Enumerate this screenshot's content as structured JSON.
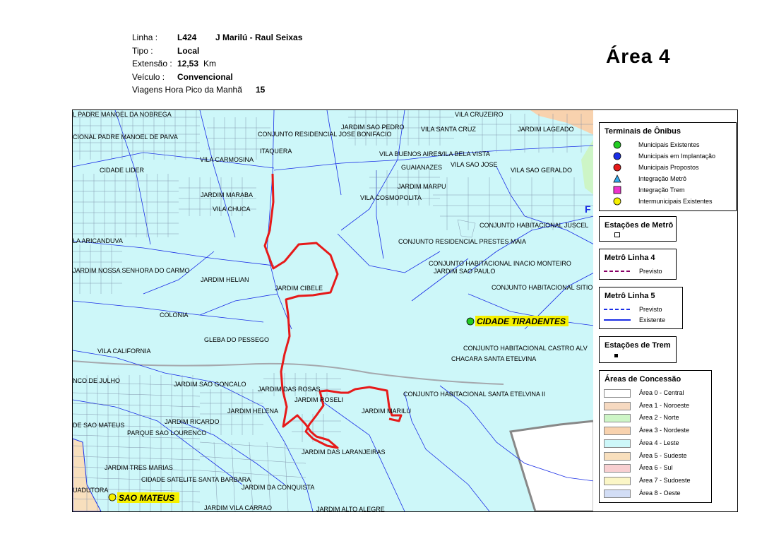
{
  "header": {
    "linha_label": "Linha :",
    "linha_code": "L424",
    "linha_name": "J Marilú - Raul Seixas",
    "tipo_label": "Tipo :",
    "tipo_value": "Local",
    "extensao_label": "Extensão :",
    "extensao_value": "12,53",
    "extensao_unit": "Km",
    "veiculo_label": "Veículo :",
    "veiculo_value": "Convencional",
    "viagens_label": "Viagens Hora Pico da Manhã",
    "viagens_value": "15"
  },
  "area_title": "Área  4",
  "map": {
    "place_labels": [
      "L PADRE MANOEL DA NOBREGA",
      "CIONAL PADRE MANOEL DE PAIVA",
      "CIDADE LIDER",
      "VILA CARMOSINA",
      "ITAQUERA",
      "CONJUNTO RESIDENCIAL JOSE BONIFACIO",
      "JARDIM SAO PEDRO",
      "VILA SANTA CRUZ",
      "VILA CRUZEIRO",
      "JARDIM LAGEADO",
      "VILA BUENOS AIRES",
      "VILA BELA VISTA",
      "GUAIANAZES",
      "VILA SAO JOSE",
      "VILA SAO GERALDO",
      "JARDIM MARPU",
      "VILA COSMOPOLITA",
      "JARDIM MARABA",
      "VILA CHUCA",
      "JARDIM HELIAN",
      "JARDIM CIBELE",
      "COLONIA",
      "GLEBA DO PESSEGO",
      "VILA CALIFORNIA",
      "JARDIM SAO GONCALO",
      "JARDIM DAS ROSAS",
      "JARDIM ROSELI",
      "JARDIM HELENA",
      "JARDIM MARILU",
      "JARDIM RICARDO",
      "PARQUE SAO LOURENCO",
      "JARDIM DAS LARANJEIRAS",
      "JARDIM TRES MARIAS",
      "CIDADE SATELITE SANTA BARBARA",
      "JARDIM DA CONQUISTA",
      "JARDIM VILA CARRAO",
      "JARDIM ALTO ALEGRE",
      "UADUTORA",
      "DE SAO MATEUS",
      "NCO DE JULHO",
      "LA ARICANDUVA",
      "JARDIM NOSSA SENHORA DO CARMO",
      "CONJUNTO RESIDENCIAL PRESTES MAIA",
      "CONJUNTO HABITACIONAL JUSCEL",
      "CONJUNTO HABITACIONAL INACIO MONTEIRO",
      "JARDIM SAO PAULO",
      "CONJUNTO HABITACIONAL SITIO",
      "CONJUNTO HABITACIONAL CASTRO ALV",
      "CHACARA SANTA ETELVINA",
      "CONJUNTO HABITACIONAL SANTA ETELVINA II",
      "F"
    ],
    "terminal_labels": [
      "CIDADE TIRADENTES",
      "SAO MATEUS"
    ]
  },
  "legend": {
    "terminais": {
      "title": "Terminais de Ônibus",
      "items": [
        {
          "label": "Municipais Existentes",
          "color": "#22cc22",
          "shape": "circle"
        },
        {
          "label": "Municipais em Implantação",
          "color": "#1a2ee6",
          "shape": "circle"
        },
        {
          "label": "Municipais Propostos",
          "color": "#e61a1a",
          "shape": "circle"
        },
        {
          "label": "Integração Metrô",
          "color": "#33aaee",
          "shape": "triangle"
        },
        {
          "label": "Integração Trem",
          "color": "#ee33cc",
          "shape": "square"
        },
        {
          "label": "Intermunicipais Existentes",
          "color": "#f5f000",
          "shape": "circle"
        }
      ]
    },
    "estacoes_metro": {
      "title": "Estações de Metrô"
    },
    "metro4": {
      "title": "Metrô Linha 4",
      "items": [
        {
          "label": "Previsto",
          "color": "#880066",
          "style": "dashed"
        }
      ]
    },
    "metro5": {
      "title": "Metrô Linha 5",
      "items": [
        {
          "label": "Previsto",
          "color": "#1a2ee6",
          "style": "dashed"
        },
        {
          "label": "Existente",
          "color": "#1a2ee6",
          "style": "solid"
        }
      ]
    },
    "estacoes_trem": {
      "title": "Estações de Trem"
    },
    "areas": {
      "title": "Áreas de Concessão",
      "items": [
        {
          "label": "Área 0 - Central",
          "color": "#ffffff"
        },
        {
          "label": "Área 1 - Noroeste",
          "color": "#f6d9c0"
        },
        {
          "label": "Área 2 - Norte",
          "color": "#cdf5c6"
        },
        {
          "label": "Área 3 - Nordeste",
          "color": "#f8d2ae"
        },
        {
          "label": "Área 4 - Leste",
          "color": "#cdf7f9"
        },
        {
          "label": "Área 5 - Sudeste",
          "color": "#f8dfbd"
        },
        {
          "label": "Área 6 - Sul",
          "color": "#f8cfd1"
        },
        {
          "label": "Área 7 - Sudoeste",
          "color": "#fbf6c6"
        },
        {
          "label": "Área 8 - Oeste",
          "color": "#d2ddf5"
        }
      ]
    }
  }
}
